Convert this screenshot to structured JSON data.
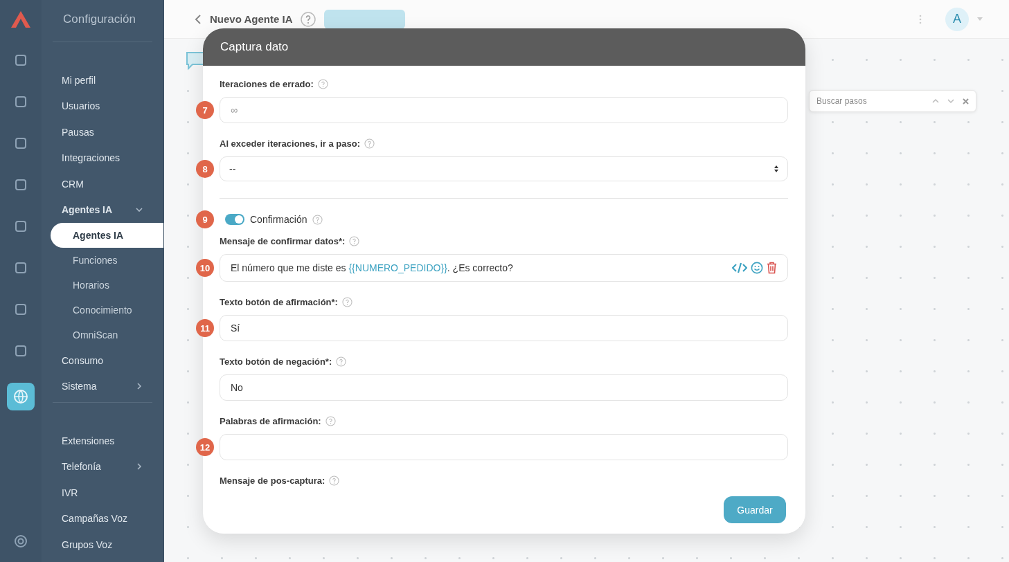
{
  "sidebar": {
    "title": "Configuración",
    "sections": [
      {
        "items": [
          {
            "label": "Mi perfil",
            "selected": false
          },
          {
            "label": "Usuarios",
            "selected": false
          },
          {
            "label": "Pausas",
            "selected": false
          },
          {
            "label": "Integraciones",
            "selected": false
          },
          {
            "label": "CRM",
            "selected": false
          },
          {
            "label": "Agentes IA",
            "selected": false,
            "expanded": true,
            "children": [
              {
                "label": "Agentes IA",
                "selected": true
              },
              {
                "label": "Funciones",
                "selected": false
              },
              {
                "label": "Horarios",
                "selected": false
              },
              {
                "label": "Conocimiento",
                "selected": false
              },
              {
                "label": "OmniScan",
                "selected": false
              }
            ]
          },
          {
            "label": "Consumo",
            "selected": false
          },
          {
            "label": "Sistema",
            "selected": false,
            "expanded": false
          }
        ]
      },
      {
        "items": [
          {
            "label": "Extensiones",
            "selected": false
          },
          {
            "label": "Telefonía",
            "selected": false,
            "expanded": false
          },
          {
            "label": "IVR",
            "selected": false
          },
          {
            "label": "Campañas Voz",
            "selected": false
          },
          {
            "label": "Grupos Voz",
            "selected": false
          }
        ]
      }
    ]
  },
  "header": {
    "title": "Nuevo Agente IA",
    "avatar": "A"
  },
  "canvas": {
    "search_placeholder": "Buscar pasos"
  },
  "modal": {
    "title": "Captura dato",
    "fields": [
      {
        "kind": "input",
        "label": "Iteraciones de errado:",
        "placeholder": "∞",
        "step": "7"
      },
      {
        "kind": "select",
        "label": "Al exceder iteraciones, ir a paso:",
        "value": "--",
        "step": "8"
      },
      {
        "kind": "toggle",
        "label": "Confirmación",
        "on": true,
        "step": "9"
      },
      {
        "kind": "message",
        "label": "Mensaje de confirmar datos*:",
        "before": "El número que me diste es ",
        "variable": "{{NUMERO_PEDIDO}}",
        "after": ". ¿Es correcto?",
        "step": "10"
      },
      {
        "kind": "input",
        "label": "Texto botón de afirmación*:",
        "value": "Sí",
        "step": "11"
      },
      {
        "kind": "input",
        "label": "Texto botón de negación*:",
        "value": "No"
      },
      {
        "kind": "input",
        "label": "Palabras de afirmación:",
        "step": "12"
      },
      {
        "kind": "heading",
        "label": "Mensaje de pos-captura:"
      }
    ],
    "save": "Guardar"
  }
}
